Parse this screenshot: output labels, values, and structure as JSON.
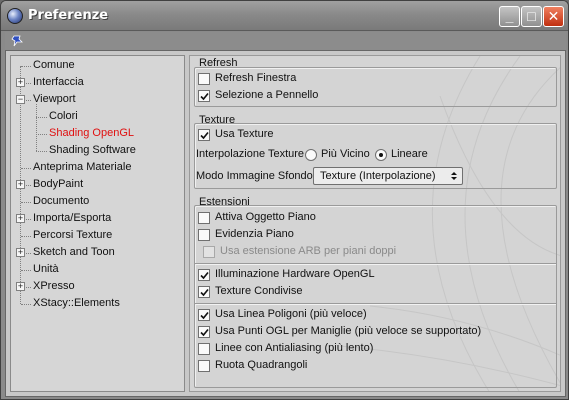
{
  "window": {
    "title": "Preferenze"
  },
  "titlebar": {
    "minimize_glyph": "_",
    "maximize_glyph": "□",
    "close_glyph": "✕"
  },
  "toolbar": {
    "icon": "pin-icon"
  },
  "sidebar": {
    "items": [
      {
        "label": "Comune",
        "expandable": false,
        "active": false,
        "indent": 0
      },
      {
        "label": "Interfaccia",
        "expandable": true,
        "expanded": false,
        "active": false,
        "indent": 0
      },
      {
        "label": "Viewport",
        "expandable": true,
        "expanded": true,
        "active": false,
        "indent": 0
      },
      {
        "label": "Colori",
        "expandable": false,
        "active": false,
        "indent": 1
      },
      {
        "label": "Shading OpenGL",
        "expandable": false,
        "active": true,
        "indent": 1
      },
      {
        "label": "Shading Software",
        "expandable": false,
        "active": false,
        "indent": 1
      },
      {
        "label": "Anteprima Materiale",
        "expandable": false,
        "active": false,
        "indent": 0
      },
      {
        "label": "BodyPaint",
        "expandable": true,
        "expanded": false,
        "active": false,
        "indent": 0
      },
      {
        "label": "Documento",
        "expandable": false,
        "active": false,
        "indent": 0
      },
      {
        "label": "Importa/Esporta",
        "expandable": true,
        "expanded": false,
        "active": false,
        "indent": 0
      },
      {
        "label": "Percorsi Texture",
        "expandable": false,
        "active": false,
        "indent": 0
      },
      {
        "label": "Sketch and Toon",
        "expandable": true,
        "expanded": false,
        "active": false,
        "indent": 0
      },
      {
        "label": "Unità",
        "expandable": false,
        "active": false,
        "indent": 0
      },
      {
        "label": "XPresso",
        "expandable": true,
        "expanded": false,
        "active": false,
        "indent": 0
      },
      {
        "label": "XStacy::Elements",
        "expandable": false,
        "active": false,
        "indent": 0
      }
    ],
    "active_color": "#e01010"
  },
  "refresh": {
    "title": "Refresh",
    "items": [
      {
        "label": "Refresh Finestra",
        "checked": false,
        "disabled": false
      },
      {
        "label": "Selezione a Pennello",
        "checked": true,
        "disabled": false
      }
    ]
  },
  "texture": {
    "title": "Texture",
    "use_texture": {
      "label": "Usa Texture",
      "checked": true
    },
    "interpolation": {
      "label": "Interpolazione Texture",
      "options": [
        {
          "label": "Più Vicino",
          "selected": false
        },
        {
          "label": "Lineare",
          "selected": true
        }
      ]
    },
    "background_mode": {
      "label": "Modo Immagine Sfondo",
      "value": "Texture (Interpolazione)"
    }
  },
  "extensions": {
    "title": "Estensioni",
    "groups": [
      [
        {
          "label": "Attiva Oggetto Piano",
          "checked": false,
          "disabled": false,
          "indent": 0
        },
        {
          "label": "Evidenzia Piano",
          "checked": false,
          "disabled": false,
          "indent": 0
        },
        {
          "label": "Usa estensione ARB per piani doppi",
          "checked": false,
          "disabled": true,
          "indent": 1
        }
      ],
      [
        {
          "label": "Illuminazione Hardware OpenGL",
          "checked": true,
          "disabled": false,
          "indent": 0
        },
        {
          "label": "Texture Condivise",
          "checked": true,
          "disabled": false,
          "indent": 0
        }
      ],
      [
        {
          "label": "Usa Linea Poligoni (più veloce)",
          "checked": true,
          "disabled": false,
          "indent": 0
        },
        {
          "label": "Usa Punti OGL per Maniglie (più veloce se supportato)",
          "checked": true,
          "disabled": false,
          "indent": 0
        },
        {
          "label": "Linee con Antialiasing (più lento)",
          "checked": false,
          "disabled": false,
          "indent": 0
        },
        {
          "label": "Ruota Quadrangoli",
          "checked": false,
          "disabled": false,
          "indent": 0
        }
      ]
    ]
  }
}
